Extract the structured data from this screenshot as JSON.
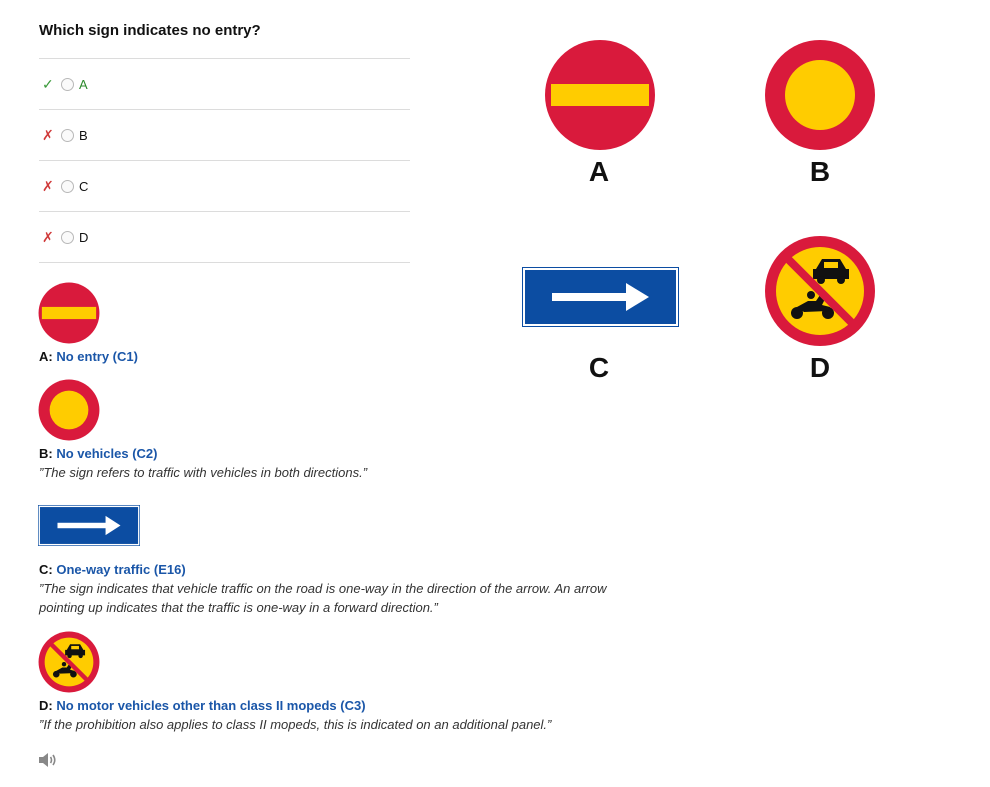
{
  "question": "Which sign indicates no entry?",
  "options": [
    {
      "mark": "✓",
      "label": "A"
    },
    {
      "mark": "✗",
      "label": "B"
    },
    {
      "mark": "✗",
      "label": "C"
    },
    {
      "mark": "✗",
      "label": "D"
    }
  ],
  "signs": {
    "A": "A",
    "B": "B",
    "C": "C",
    "D": "D"
  },
  "explanations": [
    {
      "letter": "A:",
      "title": "No entry (C1)",
      "quote": ""
    },
    {
      "letter": "B:",
      "title": "No vehicles (C2)",
      "quote": "”The sign refers to traffic with vehicles in both directions.”"
    },
    {
      "letter": "C:",
      "title": "One-way traffic (E16)",
      "quote": "”The sign indicates that vehicle traffic on the road is one-way in the direction of the arrow. An arrow pointing up indicates that the traffic is one-way in a forward direction.”"
    },
    {
      "letter": "D:",
      "title": "No motor vehicles other than class II mopeds (C3)",
      "quote": "”If the prohibition also applies to class II mopeds, this is indicated on an additional panel.”"
    }
  ],
  "colors": {
    "red": "#d91a3c",
    "yellow": "#ffcc00",
    "blue": "#0c4da2",
    "link": "#1a56a8",
    "correct": "#2c8a2c",
    "wrong": "#d03a3a"
  },
  "icons": {
    "speaker": "speaker-icon"
  }
}
